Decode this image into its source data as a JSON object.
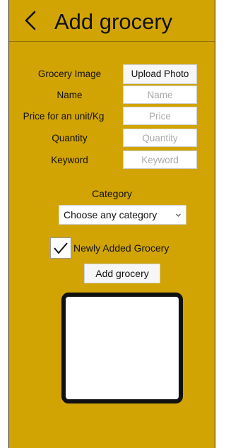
{
  "header": {
    "title": "Add grocery",
    "back_icon": "chevron-left-icon"
  },
  "form": {
    "image_label": "Grocery Image",
    "upload_label": "Upload Photo",
    "name_label": "Name",
    "name_placeholder": "Name",
    "price_label": "Price for an unit/Kg",
    "price_placeholder": "Price",
    "quantity_label": "Quantity",
    "quantity_placeholder": "Quantity",
    "keyword_label": "Keyword",
    "keyword_placeholder": "Keyword"
  },
  "category": {
    "label": "Category",
    "selected": "Choose any category",
    "dropdown_icon": "chevron-down-icon"
  },
  "newly_added": {
    "label": "Newly Added Grocery",
    "checked": true
  },
  "actions": {
    "add_label": "Add grocery"
  },
  "colors": {
    "background": "#d1a404",
    "field": "#ffffff",
    "text": "#111111",
    "placeholder": "#a9a9a9"
  }
}
